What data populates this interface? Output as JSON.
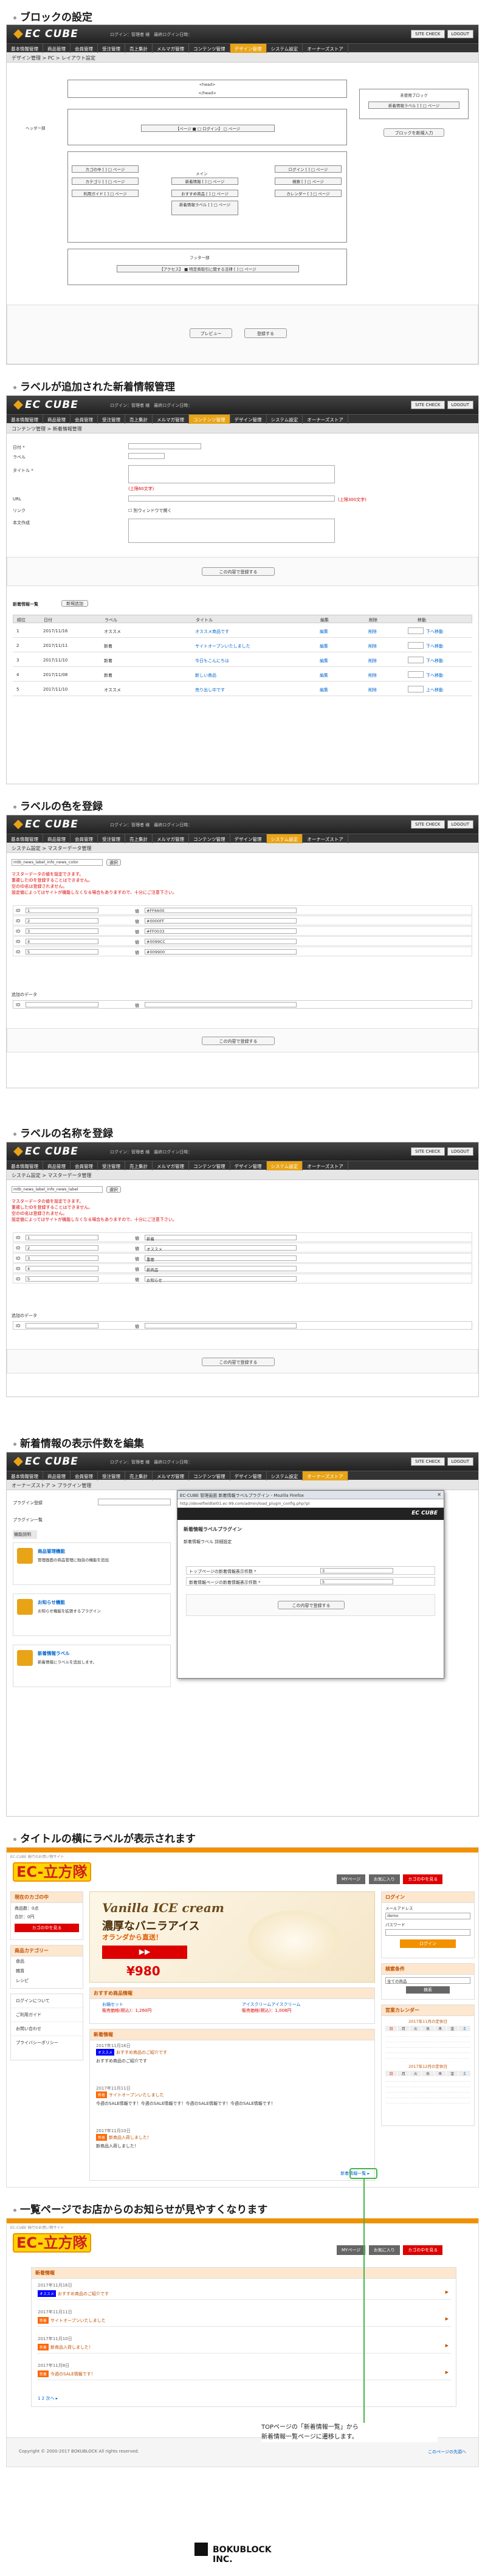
{
  "sections": {
    "s1": "ブロックの設定",
    "s2": "ラベルが追加された新着情報管理",
    "s3": "ラベルの色を登録",
    "s4": "ラベルの名称を登録",
    "s5": "新着情報の表示件数を編集",
    "s6": "タイトルの横にラベルが表示されます",
    "s7": "一覧ページでお店からのお知らせが見やすくなります"
  },
  "admin": {
    "logo": "EC CUBE",
    "info": "ログイン：管理者 様　最終ログイン日時：",
    "site_check": "SITE CHECK",
    "logout": "LOGOUT",
    "nav": [
      "基本情報管理",
      "商品管理",
      "会員管理",
      "受注管理",
      "売上集計",
      "メルマガ管理",
      "コンテンツ管理",
      "デザイン管理",
      "システム設定",
      "オーナーズストア"
    ]
  },
  "block": {
    "crumb": "デザイン管理 > PC > レイアウト設定",
    "head": "<head>",
    "head_end": "</head>",
    "header_label": "ヘッダー部",
    "header_item": "【ページ ■ □ ログイン】 □ ページ",
    "main_label": "メイン",
    "left_items": [
      "カゴの中 [ ] □ ページ",
      "カテゴリ [ ] □ ページ",
      "利用ガイド [ ] □ ページ"
    ],
    "center_items": [
      "新着情報 [ ] □ ページ",
      "おすすめ商品 [ ] □ ページ",
      "新着情報ラベル [ ] □ ページ"
    ],
    "right_items": [
      "ログイン [ ] □ ページ",
      "検索 [ ] □ ページ",
      "カレンダー [ ] □ ページ"
    ],
    "footer_label": "フッター部",
    "footer_item": "【アクセス】 ■ 特定商取引に関する法律 [ ] □ ページ",
    "unused_label": "未使用ブロック",
    "unused_item": "新着情報ラベル [ ] □ ページ",
    "new_block_btn": "ブロックを新規入力",
    "preview_btn": "プレビュー",
    "save_btn": "登録する"
  },
  "news": {
    "crumb": "コンテンツ管理 > 新着情報管理",
    "labels": {
      "date": "日付 *",
      "label": "ラベル",
      "title": "タイトル *",
      "url": "URL",
      "link": "リンク",
      "body": "本文作成"
    },
    "hint_title": "(上限60文字)",
    "hint_url": "(上限300文字)",
    "link_check": "別ウィンドウで開く",
    "submit": "この内容で登録する",
    "list_title": "新着情報一覧",
    "list_btn": "新規追加",
    "cols": [
      "順位",
      "日付",
      "ラベル",
      "タイトル",
      "編集",
      "削除",
      "移動"
    ],
    "rows": [
      {
        "rank": "1",
        "date": "2017/11/16",
        "label": "オススメ",
        "title": "オススメ商品です",
        "edit": "編集",
        "del": "削除",
        "move": "下へ移動"
      },
      {
        "rank": "2",
        "date": "2017/11/11",
        "label": "新着",
        "title": "サイトオープンいたしました",
        "edit": "編集",
        "del": "削除",
        "move": "下へ移動"
      },
      {
        "rank": "3",
        "date": "2017/11/10",
        "label": "新着",
        "title": "今日もこんにちは",
        "edit": "編集",
        "del": "削除",
        "move": "下へ移動"
      },
      {
        "rank": "4",
        "date": "2017/11/08",
        "label": "新着",
        "title": "新しい商品",
        "edit": "編集",
        "del": "削除",
        "move": "下へ移動"
      },
      {
        "rank": "5",
        "date": "2017/11/10",
        "label": "オススメ",
        "title": "売り出し中です",
        "edit": "編集",
        "del": "削除",
        "move": "上へ移動"
      }
    ]
  },
  "color": {
    "crumb": "システム設定 > マスターデータ管理",
    "select": "mtb_news_label_info_news_color",
    "select_btn": "選択",
    "notes": [
      "マスターデータの値を設定できます。",
      "重複したIDを登録することはできません。",
      "空のID名は登録されません。",
      "設定値によってはサイトが機能しなくなる場合もありますので、十分にご注意下さい。"
    ],
    "rows": [
      {
        "id": "1",
        "value": "#FF6600"
      },
      {
        "id": "2",
        "value": "#0000FF"
      },
      {
        "id": "3",
        "value": "#FF0033"
      },
      {
        "id": "4",
        "value": "#0099CC"
      },
      {
        "id": "5",
        "value": "#009900"
      }
    ],
    "add_label": "追加のデータ",
    "submit": "この内容で登録する",
    "id_label": "ID",
    "val_label": "値"
  },
  "name": {
    "crumb": "システム設定 > マスターデータ管理",
    "select": "mtb_news_label_info_news_label",
    "select_btn": "選択",
    "notes": [
      "マスターデータの値を設定できます。",
      "重複したIDを登録することはできません。",
      "空のID名は登録されません。",
      "設定値によってはサイトが機能しなくなる場合もありますので、十分にご注意下さい。"
    ],
    "rows": [
      {
        "id": "1",
        "value": "新着"
      },
      {
        "id": "2",
        "value": "オススメ"
      },
      {
        "id": "3",
        "value": "重要"
      },
      {
        "id": "4",
        "value": "新商品"
      },
      {
        "id": "5",
        "value": "お知らせ"
      }
    ],
    "add_label": "追加のデータ",
    "submit": "この内容で登録する",
    "id_label": "ID",
    "val_label": "値"
  },
  "plugin": {
    "crumb": "オーナーズストア > プラグイン管理",
    "label_upload": "プラグイン登録",
    "label_list": "プラグイン一覧",
    "col_label": "機能説明",
    "items": [
      {
        "name": "商品管理機能",
        "desc": "管理画面の商品管理に独自の機能を追加"
      },
      {
        "name": "お知らせ機能",
        "desc": "お知らせ機能を拡張するプラグイン"
      },
      {
        "name": "新着情報ラベル",
        "desc": "新着情報にラベルを追加します。"
      }
    ],
    "window_title": "EC-CUBE 管理画面 新着情報ラベルプラグイン - Mozilla Firefox",
    "window_url": "http://develfieldtel01.ec-99.com/admin/load_plugin_config.php?pl",
    "popup_title": "新着情報ラベルプラグイン",
    "popup_sub": "新着情報ラベル 詳細設定",
    "popup_row1": "トップページの新着情報表示件数 *",
    "popup_row2": "新着情報ページの新着情報表示件数 *",
    "popup_val1": "3",
    "popup_val2": "5",
    "popup_submit": "この内容で登録する",
    "popup_logo": "EC CUBE"
  },
  "store": {
    "logo": "EC-立方隊",
    "tagline": "EC-CUBE 発行のお買い物サイト",
    "top_links": [
      "MYページ",
      "お気に入り",
      "カゴの中を見る"
    ],
    "cart_title": "現在のカゴの中",
    "cart_rows": [
      "商品数：0点",
      "合計：0円"
    ],
    "cart_btn": "カゴの中を見る",
    "category_title": "商品カテゴリー",
    "categories": [
      "食品",
      "雑貨",
      "レシピ"
    ],
    "guide_items": [
      "ログインについて",
      "ご利用ガイド",
      "お問い合わせ",
      "プライバシーポリシー"
    ],
    "banner_title": "Vanilla ICE cream",
    "banner_sub": "濃厚なバニラアイス",
    "banner_copy": "オランダから直送！",
    "banner_price": "¥980",
    "recommend_title": "おすすめ商品情報",
    "recommend_items": [
      {
        "name": "お鍋セット",
        "price": "販売価格(税込)：1,260円"
      },
      {
        "name": "アイスクリームアイスクリーム",
        "price": "販売価格(税込)：1,008円"
      }
    ],
    "news_title": "新着情報",
    "news_items": [
      {
        "date": "2017年11月16日",
        "label": "オススメ",
        "title": "おすすめ商品のご紹介です",
        "body": "おすすめ商品のご紹介です"
      },
      {
        "date": "2017年11月11日",
        "label": "新着",
        "title": "サイトオープンいたしました",
        "body": "今週のSALE情報です！今週のSALE情報です！今週のSALE情報です！今週のSALE情報です！"
      },
      {
        "date": "2017年11月10日",
        "label": "新着",
        "title": "新商品入荷しました！",
        "body": "新商品入荷しました！"
      }
    ],
    "news_more": "新着情報一覧 ▸",
    "login_title": "ログイン",
    "login_email": "メールアドレス",
    "login_user": "demo",
    "login_pass": "パスワード",
    "login_btn": "ログイン",
    "search_title": "検索条件",
    "search_sel": "全ての商品",
    "search_btn": "検索",
    "cal_title": "営業カレンダー",
    "cal_month1": "2017年11月の定休日",
    "cal_month2": "2017年12月の定休日",
    "cal_days": [
      "日",
      "月",
      "火",
      "水",
      "木",
      "金",
      "土"
    ]
  },
  "newslist": {
    "crumb_title": "新着情報",
    "items": [
      {
        "date": "2017年11月16日",
        "label": "オススメ",
        "title": "おすすめ商品のご紹介です"
      },
      {
        "date": "2017年11月11日",
        "label": "新着",
        "title": "サイトオープンいたしました"
      },
      {
        "date": "2017年11月10日",
        "label": "新着",
        "title": "新商品入荷しました！"
      },
      {
        "date": "2017年11月8日",
        "label": "新着",
        "title": "今週のSALE情報です！"
      }
    ],
    "pager": "1  2  次へ ▸",
    "copyright": "Copyright © 2000-2017 BOKUBLOCK All rights reserved.",
    "pagetop": "このページの先頭へ"
  },
  "callout": {
    "text1": "TOPページの「新着情報一覧」から",
    "text_hl": "「新着情報一覧」",
    "text2": "新着情報一覧ページに遷移します。"
  },
  "company": "BOKUBLOCK INC.",
  "colors": {
    "ec_orange": "#e8a317",
    "store_orange": "#f29100",
    "label_new": "#FF6600",
    "label_rec": "#0000FF",
    "arrow_green": "#43b649"
  }
}
